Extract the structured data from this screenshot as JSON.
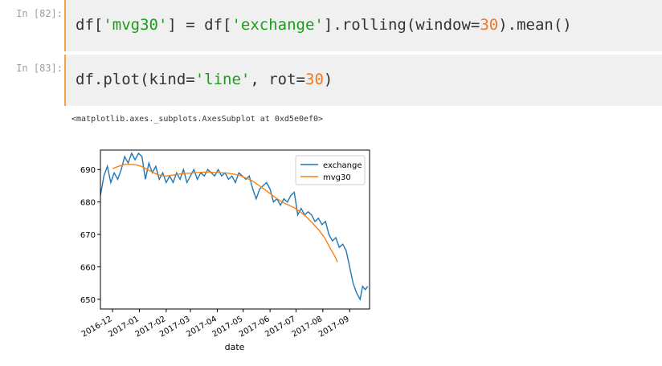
{
  "cells": [
    {
      "prompt": "In [82]:",
      "code_tokens": [
        {
          "t": "df[",
          "c": "op"
        },
        {
          "t": "'mvg30'",
          "c": "str"
        },
        {
          "t": "] = df[",
          "c": "op"
        },
        {
          "t": "'exchange'",
          "c": "str"
        },
        {
          "t": "].rolling(window=",
          "c": "op"
        },
        {
          "t": "30",
          "c": "num"
        },
        {
          "t": ").mean()",
          "c": "op"
        }
      ]
    },
    {
      "prompt": "In [83]:",
      "code_tokens": [
        {
          "t": "df.plot(kind=",
          "c": "op"
        },
        {
          "t": "'line'",
          "c": "str"
        },
        {
          "t": ", rot=",
          "c": "op"
        },
        {
          "t": "30",
          "c": "num"
        },
        {
          "t": ")",
          "c": "op"
        }
      ]
    }
  ],
  "output_text": "<matplotlib.axes._subplots.AxesSubplot at 0xd5e0ef0>",
  "chart_data": {
    "type": "line",
    "xlabel": "date",
    "ylabel": "",
    "xlim": [
      "2016-11-17",
      "2017-09-24"
    ],
    "ylim": [
      647,
      696
    ],
    "x_ticks": [
      "2016-12",
      "2017-01",
      "2017-02",
      "2017-03",
      "2017-04",
      "2017-05",
      "2017-06",
      "2017-07",
      "2017-08",
      "2017-09"
    ],
    "y_ticks": [
      650,
      660,
      670,
      680,
      690
    ],
    "grid": false,
    "legend": "top-right",
    "series": [
      {
        "name": "exchange",
        "color": "#1f77b4",
        "points": [
          [
            "2016-11-17",
            682
          ],
          [
            "2016-11-21",
            688
          ],
          [
            "2016-11-25",
            691
          ],
          [
            "2016-11-29",
            686
          ],
          [
            "2016-12-03",
            689
          ],
          [
            "2016-12-07",
            687
          ],
          [
            "2016-12-11",
            690
          ],
          [
            "2016-12-15",
            694
          ],
          [
            "2016-12-19",
            692
          ],
          [
            "2016-12-23",
            695
          ],
          [
            "2016-12-27",
            693
          ],
          [
            "2016-12-31",
            695
          ],
          [
            "2017-01-04",
            694
          ],
          [
            "2017-01-08",
            687
          ],
          [
            "2017-01-12",
            692
          ],
          [
            "2017-01-16",
            689
          ],
          [
            "2017-01-20",
            691
          ],
          [
            "2017-01-24",
            687
          ],
          [
            "2017-01-28",
            689
          ],
          [
            "2017-02-01",
            686
          ],
          [
            "2017-02-05",
            688
          ],
          [
            "2017-02-09",
            686
          ],
          [
            "2017-02-13",
            689
          ],
          [
            "2017-02-17",
            687
          ],
          [
            "2017-02-21",
            690
          ],
          [
            "2017-02-25",
            686
          ],
          [
            "2017-03-01",
            688
          ],
          [
            "2017-03-05",
            690
          ],
          [
            "2017-03-09",
            687
          ],
          [
            "2017-03-13",
            689
          ],
          [
            "2017-03-17",
            688
          ],
          [
            "2017-03-21",
            690
          ],
          [
            "2017-03-25",
            689
          ],
          [
            "2017-03-29",
            688
          ],
          [
            "2017-04-02",
            690
          ],
          [
            "2017-04-06",
            688
          ],
          [
            "2017-04-10",
            689
          ],
          [
            "2017-04-14",
            687
          ],
          [
            "2017-04-18",
            688
          ],
          [
            "2017-04-22",
            686
          ],
          [
            "2017-04-26",
            689
          ],
          [
            "2017-04-30",
            688
          ],
          [
            "2017-05-04",
            687
          ],
          [
            "2017-05-08",
            688
          ],
          [
            "2017-05-12",
            684
          ],
          [
            "2017-05-16",
            681
          ],
          [
            "2017-05-20",
            684
          ],
          [
            "2017-05-24",
            685
          ],
          [
            "2017-05-28",
            686
          ],
          [
            "2017-06-01",
            684
          ],
          [
            "2017-06-05",
            680
          ],
          [
            "2017-06-09",
            681
          ],
          [
            "2017-06-13",
            679
          ],
          [
            "2017-06-17",
            681
          ],
          [
            "2017-06-21",
            680
          ],
          [
            "2017-06-25",
            682
          ],
          [
            "2017-06-29",
            683
          ],
          [
            "2017-07-03",
            676
          ],
          [
            "2017-07-07",
            678
          ],
          [
            "2017-07-11",
            676
          ],
          [
            "2017-07-15",
            677
          ],
          [
            "2017-07-19",
            676
          ],
          [
            "2017-07-23",
            674
          ],
          [
            "2017-07-27",
            675
          ],
          [
            "2017-07-31",
            673
          ],
          [
            "2017-08-04",
            674
          ],
          [
            "2017-08-08",
            670
          ],
          [
            "2017-08-12",
            668
          ],
          [
            "2017-08-16",
            669
          ],
          [
            "2017-08-20",
            666
          ],
          [
            "2017-08-24",
            667
          ],
          [
            "2017-08-28",
            665
          ],
          [
            "2017-09-01",
            660
          ],
          [
            "2017-09-05",
            655
          ],
          [
            "2017-09-09",
            652
          ],
          [
            "2017-09-13",
            650
          ],
          [
            "2017-09-16",
            654
          ],
          [
            "2017-09-19",
            653
          ],
          [
            "2017-09-22",
            654
          ]
        ]
      },
      {
        "name": "mvg30",
        "color": "#ff7f0e",
        "points": [
          [
            "2016-12-01",
            690.3
          ],
          [
            "2016-12-08",
            691.0
          ],
          [
            "2016-12-15",
            691.6
          ],
          [
            "2016-12-22",
            691.6
          ],
          [
            "2016-12-29",
            691.4
          ],
          [
            "2017-01-05",
            690.8
          ],
          [
            "2017-01-12",
            689.8
          ],
          [
            "2017-01-19",
            688.8
          ],
          [
            "2017-01-26",
            688.1
          ],
          [
            "2017-02-02",
            688.0
          ],
          [
            "2017-02-09",
            688.3
          ],
          [
            "2017-02-16",
            688.6
          ],
          [
            "2017-02-23",
            688.8
          ],
          [
            "2017-03-02",
            688.9
          ],
          [
            "2017-03-09",
            689.1
          ],
          [
            "2017-03-16",
            689.2
          ],
          [
            "2017-03-23",
            689.2
          ],
          [
            "2017-03-30",
            689.1
          ],
          [
            "2017-04-06",
            689.0
          ],
          [
            "2017-04-13",
            688.9
          ],
          [
            "2017-04-20",
            688.6
          ],
          [
            "2017-04-27",
            688.2
          ],
          [
            "2017-05-04",
            687.4
          ],
          [
            "2017-05-11",
            686.6
          ],
          [
            "2017-05-18",
            685.3
          ],
          [
            "2017-05-25",
            684.0
          ],
          [
            "2017-06-01",
            682.6
          ],
          [
            "2017-06-08",
            681.2
          ],
          [
            "2017-06-15",
            680.0
          ],
          [
            "2017-06-22",
            679.1
          ],
          [
            "2017-06-29",
            678.2
          ],
          [
            "2017-07-06",
            677.0
          ],
          [
            "2017-07-13",
            675.4
          ],
          [
            "2017-07-20",
            673.5
          ],
          [
            "2017-07-27",
            671.5
          ],
          [
            "2017-08-03",
            669.0
          ],
          [
            "2017-08-10",
            665.5
          ],
          [
            "2017-08-15",
            663.2
          ],
          [
            "2017-08-18",
            661.5
          ]
        ]
      }
    ]
  }
}
